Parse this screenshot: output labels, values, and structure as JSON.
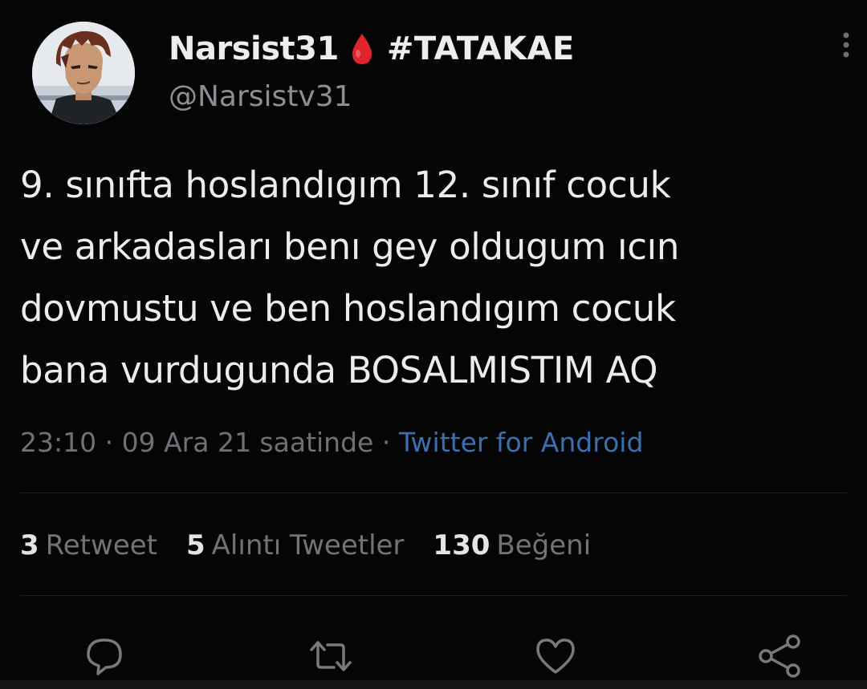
{
  "user": {
    "display_name": "Narsist31",
    "emoji": "drop-of-blood",
    "hashtag": "#TATAKAE",
    "handle": "@Narsistv31"
  },
  "tweet": {
    "lines": [
      "9. sınıfta hoslandıgım 12. sınıf cocuk",
      "ve arkadasları benı gey oldugum ıcın",
      "dovmustu ve ben hoslandıgım cocuk",
      "bana vurdugunda BOSALMISTIM AQ"
    ]
  },
  "meta": {
    "time": "23:10",
    "separator": "·",
    "date": "09 Ara 21 saatinde",
    "source": "Twitter for Android"
  },
  "stats": {
    "retweets_count": "3",
    "retweets_label": "Retweet",
    "quotes_count": "5",
    "quotes_label": "Alıntı Tweetler",
    "likes_count": "130",
    "likes_label": "Beğeni"
  },
  "colors": {
    "background": "#050505",
    "text": "#ececec",
    "muted": "#707478",
    "link": "#3a6fb0",
    "drop": "#e0242b"
  },
  "icons": [
    "reply-icon",
    "retweet-icon",
    "like-icon",
    "share-icon",
    "more-icon"
  ]
}
